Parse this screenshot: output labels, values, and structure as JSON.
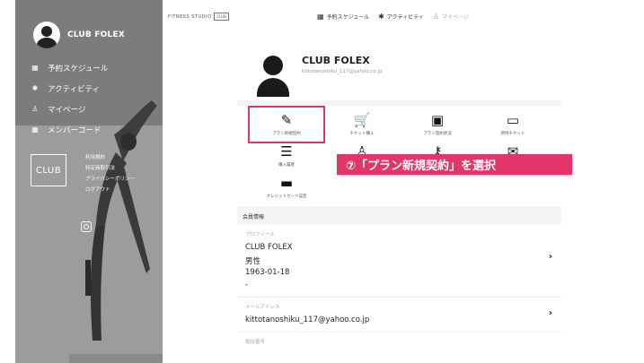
{
  "sidebar": {
    "brand": "CLUB FOLEX",
    "nav": [
      {
        "icon": "calendar-icon",
        "glyph": "▦",
        "label": "予約スケジュール"
      },
      {
        "icon": "activity-icon",
        "glyph": "✱",
        "label": "アクティビティ"
      },
      {
        "icon": "person-icon",
        "glyph": "♙",
        "label": "マイページ"
      },
      {
        "icon": "card-icon",
        "glyph": "▦",
        "label": "メンバーコード"
      }
    ],
    "logo": "CLUB",
    "links": [
      "利用規約",
      "特定商取引法",
      "プライバシーポリシー",
      "ログアウト"
    ]
  },
  "header": {
    "logo_text": "FITNESS STUDIO",
    "logo_box": "CLUB",
    "nav": [
      {
        "icon": "calendar-icon",
        "glyph": "▦",
        "label": "予約スケジュール"
      },
      {
        "icon": "activity-icon",
        "glyph": "✱",
        "label": "アクティビティ"
      },
      {
        "icon": "person-icon",
        "glyph": "♙",
        "label": "マイページ"
      }
    ]
  },
  "profile": {
    "name": "CLUB FOLEX",
    "email": "kittotanoshiku_117@yahoo.co.jp"
  },
  "menu": [
    {
      "icon": "contract-edit-icon",
      "glyph": "✎",
      "label": "プラン新規契約"
    },
    {
      "icon": "cart-icon",
      "glyph": "🛒",
      "label": "チケット購入"
    },
    {
      "icon": "id-card-icon",
      "glyph": "▣",
      "label": "プラン契約状況"
    },
    {
      "icon": "ticket-icon",
      "glyph": "▭",
      "label": "所持チケット"
    },
    {
      "icon": "list-icon",
      "glyph": "☰",
      "label": "購入履歴"
    },
    {
      "icon": "user-icon",
      "glyph": "♙",
      "label": ""
    },
    {
      "icon": "key-icon",
      "glyph": "⚷",
      "label": ""
    },
    {
      "icon": "mail-icon",
      "glyph": "✉",
      "label": ""
    },
    {
      "icon": "credit-card-icon",
      "glyph": "▬",
      "label": "クレジットカード設定"
    }
  ],
  "callout": "⑦「プラン新規契約」を選択",
  "member_info": {
    "title": "会員情報",
    "profile_label": "プロフィール",
    "profile_name": "CLUB FOLEX",
    "gender": "男性",
    "birthday": "1963-01-18",
    "dash": "-",
    "email_label": "メールアドレス",
    "email": "kittotanoshiku_117@yahoo.co.jp",
    "phone_label": "電話番号"
  },
  "colors": {
    "accent": "#e4356b"
  }
}
